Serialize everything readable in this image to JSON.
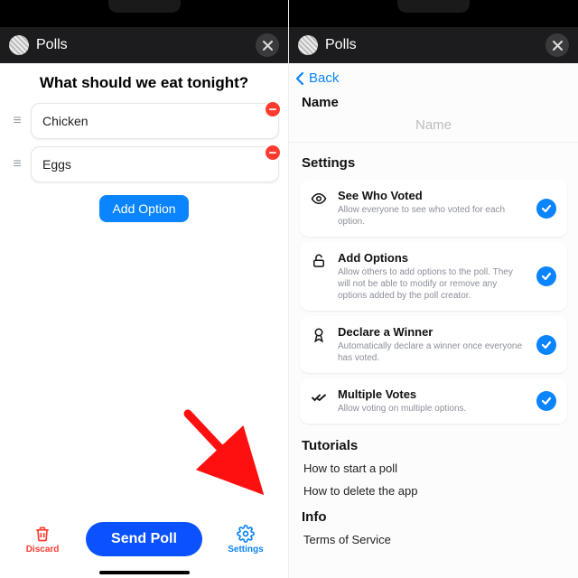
{
  "app_title": "Polls",
  "left": {
    "question": "What should we eat tonight?",
    "options": [
      "Chicken",
      "Eggs"
    ],
    "add_label": "Add Option",
    "discard_label": "Discard",
    "send_label": "Send Poll",
    "settings_label": "Settings"
  },
  "right": {
    "back_label": "Back",
    "name_header": "Name",
    "name_placeholder": "Name",
    "settings_header": "Settings",
    "settings": [
      {
        "title": "See Who Voted",
        "desc": "Allow everyone to see who voted for each option."
      },
      {
        "title": "Add Options",
        "desc": "Allow others to add options to the poll. They will not be able to modify or remove any options added by the poll creator."
      },
      {
        "title": "Declare a Winner",
        "desc": "Automatically declare a winner once everyone has voted."
      },
      {
        "title": "Multiple Votes",
        "desc": "Allow voting on multiple options."
      }
    ],
    "tutorials_header": "Tutorials",
    "tutorials": [
      "How to start a poll",
      "How to delete the app"
    ],
    "info_header": "Info",
    "info_items": [
      "Terms of Service"
    ]
  }
}
